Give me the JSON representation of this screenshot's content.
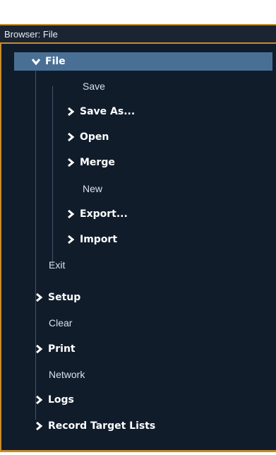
{
  "window": {
    "title": "Browser: File"
  },
  "tree": {
    "file": "File",
    "save": "Save",
    "save_as": "Save As...",
    "open": "Open",
    "merge": "Merge",
    "new": "New",
    "export": "Export...",
    "import": "Import",
    "exit": "Exit",
    "setup": "Setup",
    "clear": "Clear",
    "print": "Print",
    "network": "Network",
    "logs": "Logs",
    "record_target_lists": "Record Target Lists"
  },
  "icons": {
    "expanded": "chevron-down-icon",
    "collapsed": "chevron-right-icon"
  },
  "colors": {
    "background": "#111c2b",
    "frame": "#c98b2a",
    "selection": "#4a6f95",
    "text": "#d9e0ea"
  }
}
